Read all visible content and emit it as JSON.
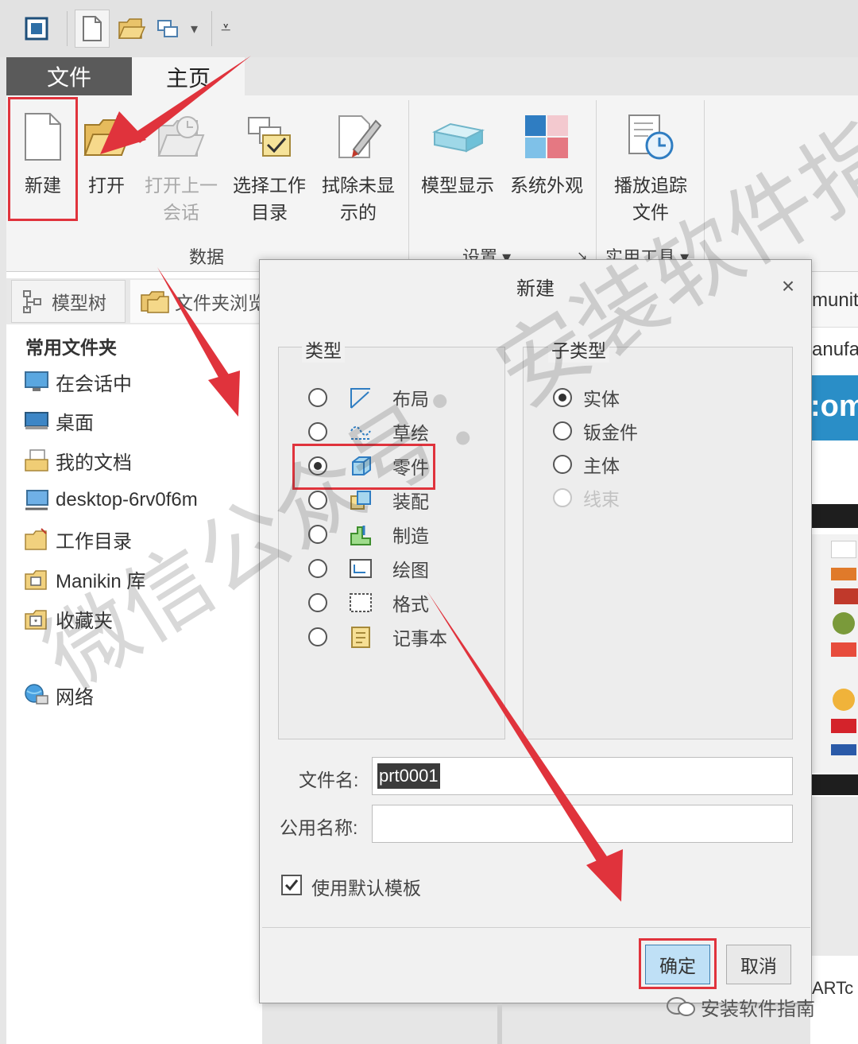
{
  "ribbon": {
    "tabs": {
      "file": "文件",
      "home": "主页"
    },
    "buttons": {
      "new": "新建",
      "open": "打开",
      "open_last_1": "打开上一",
      "open_last_2": "会话",
      "select_dir_1": "选择工作",
      "select_dir_2": "目录",
      "erase_1": "拭除未显",
      "erase_2": "示的",
      "model_display": "模型显示",
      "system_appearance": "系统外观",
      "playback_1": "播放追踪",
      "playback_2": "文件"
    },
    "groups": {
      "data": "数据",
      "settings": "设置 ▾",
      "utilities": "实用工具 ▾"
    }
  },
  "navigator": {
    "tabs": {
      "model_tree": "模型树",
      "folder_browser": "文件夹浏览"
    },
    "heading": "常用文件夹",
    "items": {
      "in_session": "在会话中",
      "desktop": "桌面",
      "my_documents": "我的文档",
      "computer": "desktop-6rv0f6m",
      "working_dir": "工作目录",
      "manikin": "Manikin 库",
      "favorites": "收藏夹",
      "network": "网络"
    }
  },
  "right_area": {
    "text_1": "munit",
    "text_2": "anufa",
    "text_3": ":om",
    "text_4": "ARTc"
  },
  "dialog": {
    "title": "新建",
    "close": "×",
    "type_label": "类型",
    "subtype_label": "子类型",
    "types": {
      "layout": "布局",
      "sketch": "草绘",
      "part": "零件",
      "assembly": "装配",
      "manufacturing": "制造",
      "drawing": "绘图",
      "format": "格式",
      "notebook": "记事本"
    },
    "selected_type": "零件",
    "subtypes": {
      "solid": "实体",
      "sheetmetal": "钣金件",
      "bulk": "主体",
      "harness": "线束"
    },
    "selected_subtype": "实体",
    "file_name_label": "文件名:",
    "file_name_value": "prt0001",
    "common_name_label": "公用名称:",
    "common_name_value": "",
    "use_default_template": "使用默认模板",
    "use_default_template_checked": true,
    "ok": "确定",
    "cancel": "取消"
  },
  "watermark": {
    "text_1": "微信公众号：安装软件指南",
    "text_2": "安装软件指南"
  },
  "colors": {
    "highlight": "#e0333c",
    "arrow": "#e0333c",
    "ok_button": "#bfe0f6",
    "file_tab": "#5a5a5a"
  }
}
